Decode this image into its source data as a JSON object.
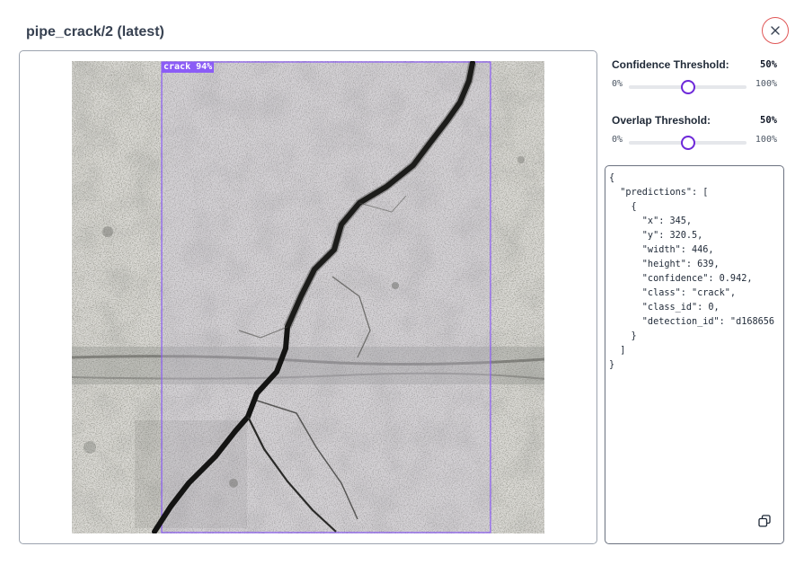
{
  "modal": {
    "title": "pipe_crack/2 (latest)"
  },
  "image": {
    "detection_label": "crack 94%",
    "box_color": "#8b5cf6"
  },
  "controls": {
    "confidence": {
      "label": "Confidence Threshold:",
      "value": "50%",
      "min": "0%",
      "max": "100%",
      "level": 0.5
    },
    "overlap": {
      "label": "Overlap Threshold:",
      "value": "50%",
      "min": "0%",
      "max": "100%",
      "level": 0.5
    },
    "accent_color": "#6d28d9"
  },
  "json_output": {
    "text": "{\n  \"predictions\": [\n    {\n      \"x\": 345,\n      \"y\": 320.5,\n      \"width\": 446,\n      \"height\": 639,\n      \"confidence\": 0.942,\n      \"class\": \"crack\",\n      \"class_id\": 0,\n      \"detection_id\": \"d168656\n    }\n  ]\n}"
  },
  "icons": {
    "close": "close-icon",
    "copy": "copy-icon"
  }
}
